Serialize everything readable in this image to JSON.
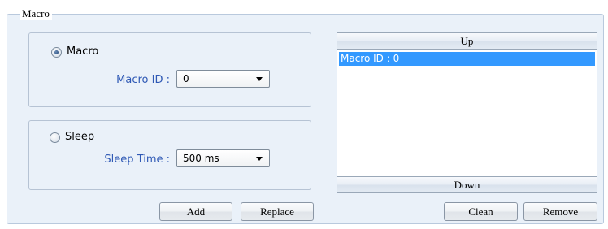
{
  "group": {
    "title": "Macro"
  },
  "macro_option": {
    "label": "Macro",
    "selected": true,
    "field_label": "Macro ID :",
    "value": "0"
  },
  "sleep_option": {
    "label": "Sleep",
    "selected": false,
    "field_label": "Sleep Time :",
    "value": "500 ms"
  },
  "buttons": {
    "add": "Add",
    "replace": "Replace",
    "clean": "Clean",
    "remove": "Remove"
  },
  "list": {
    "up_label": "Up",
    "down_label": "Down",
    "items": [
      "Macro ID : 0"
    ],
    "selected_index": 0
  },
  "colors": {
    "panel_bg": "#eaf1f9",
    "field_label": "#2f59b5",
    "selection": "#3399ff"
  }
}
